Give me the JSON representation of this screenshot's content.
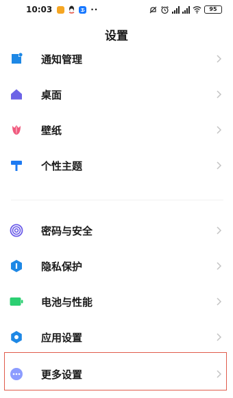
{
  "status_bar": {
    "time": "10:03",
    "battery": "95",
    "more_dots": "··"
  },
  "page": {
    "title": "设置"
  },
  "settings": {
    "items": [
      {
        "label": "通知管理",
        "icon": "notification-icon",
        "color": "#1e88e5"
      },
      {
        "label": "桌面",
        "icon": "home-icon",
        "color": "#6c63e6"
      },
      {
        "label": "壁纸",
        "icon": "tulip-icon",
        "color": "#f05a7e"
      },
      {
        "label": "个性主题",
        "icon": "paint-roller-icon",
        "color": "#1e7bf2"
      },
      {
        "label": "密码与安全",
        "icon": "fingerprint-icon",
        "color": "#6a5be8"
      },
      {
        "label": "隐私保护",
        "icon": "privacy-shield-icon",
        "color": "#1e88e5"
      },
      {
        "label": "电池与性能",
        "icon": "battery-icon",
        "color": "#2ccf72"
      },
      {
        "label": "应用设置",
        "icon": "gear-icon",
        "color": "#1e88e5"
      },
      {
        "label": "更多设置",
        "icon": "more-icon",
        "color": "#8c9cff"
      }
    ]
  },
  "colors": {
    "highlight_border": "#e05a4a",
    "chevron": "#c4c4c4"
  }
}
